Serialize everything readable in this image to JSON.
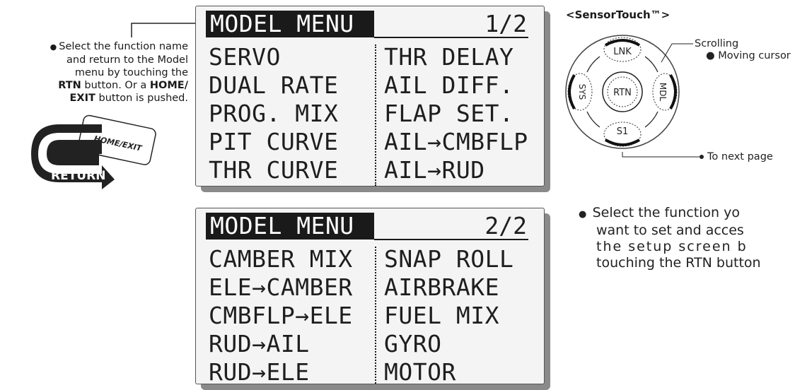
{
  "left_note": {
    "l1": "Select the function name",
    "l2": "and return to the Model",
    "l3": "menu by touching the",
    "l4_key": "RTN",
    "l4_text": " button.   Or a ",
    "l4_key2": "HOME/",
    "l5_key": "EXIT",
    "l5_text": " button is pushed."
  },
  "return_graphic": {
    "label": "RETURN",
    "key_label": "HOME/EXIT"
  },
  "screen1": {
    "title": "MODEL MENU",
    "page": "1/2",
    "left_items": [
      "SERVO",
      "DUAL RATE",
      "PROG. MIX",
      "PIT CURVE",
      "THR CURVE"
    ],
    "right_items": [
      "THR DELAY",
      "AIL DIFF.",
      "FLAP SET.",
      "AIL→CMBFLP",
      "AIL→RUD"
    ]
  },
  "screen2": {
    "title": "MODEL MENU",
    "page": "2/2",
    "left_items": [
      "CAMBER MIX",
      "ELE→CAMBER",
      "CMBFLP→ELE",
      "RUD→AIL",
      "RUD→ELE"
    ],
    "right_items": [
      "SNAP ROLL",
      "AIRBRAKE",
      "FUEL MIX",
      "GYRO",
      "MOTOR"
    ]
  },
  "sensortouch": {
    "title": "<SensorTouch™>",
    "scrolling": "Scrolling",
    "moving_cursor": "Moving cursor",
    "next_page": "To next page",
    "buttons": {
      "top": "LNK",
      "left": "SYS",
      "right": "MDL",
      "bottom": "S1",
      "center": "RTN"
    }
  },
  "right_note": {
    "l1": "Select the function yo",
    "l2": "want to set and acces",
    "l3": "the setup screen b",
    "l4": "touching the RTN button"
  }
}
